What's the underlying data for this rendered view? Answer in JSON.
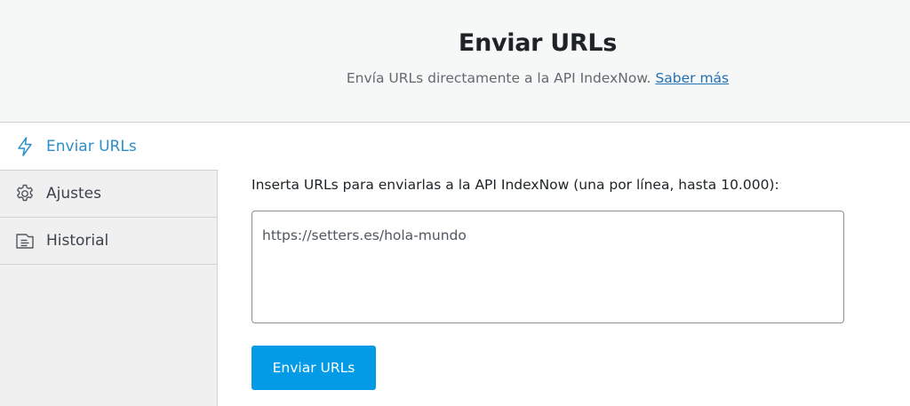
{
  "header": {
    "title": "Enviar URLs",
    "subtitle": "Envía URLs directamente a la API IndexNow.",
    "learn_more_link": "Saber más"
  },
  "sidebar": {
    "items": [
      {
        "label": "Enviar URLs",
        "icon": "lightning-icon",
        "active": true
      },
      {
        "label": "Ajustes",
        "icon": "gear-icon",
        "active": false
      },
      {
        "label": "Historial",
        "icon": "document-icon",
        "active": false
      }
    ]
  },
  "main": {
    "prompt": "Inserta URLs para enviarlas a la API IndexNow (una por línea, hasta 10.000):",
    "textarea_placeholder": "https://setters.es/hola-mundo",
    "submit_label": "Enviar URLs"
  },
  "colors": {
    "accent": "#039be5",
    "active_nav": "#2e8fc8",
    "link": "#2271b1",
    "header_bg": "#f6f7f7",
    "sidebar_bg": "#f0f0f1"
  }
}
